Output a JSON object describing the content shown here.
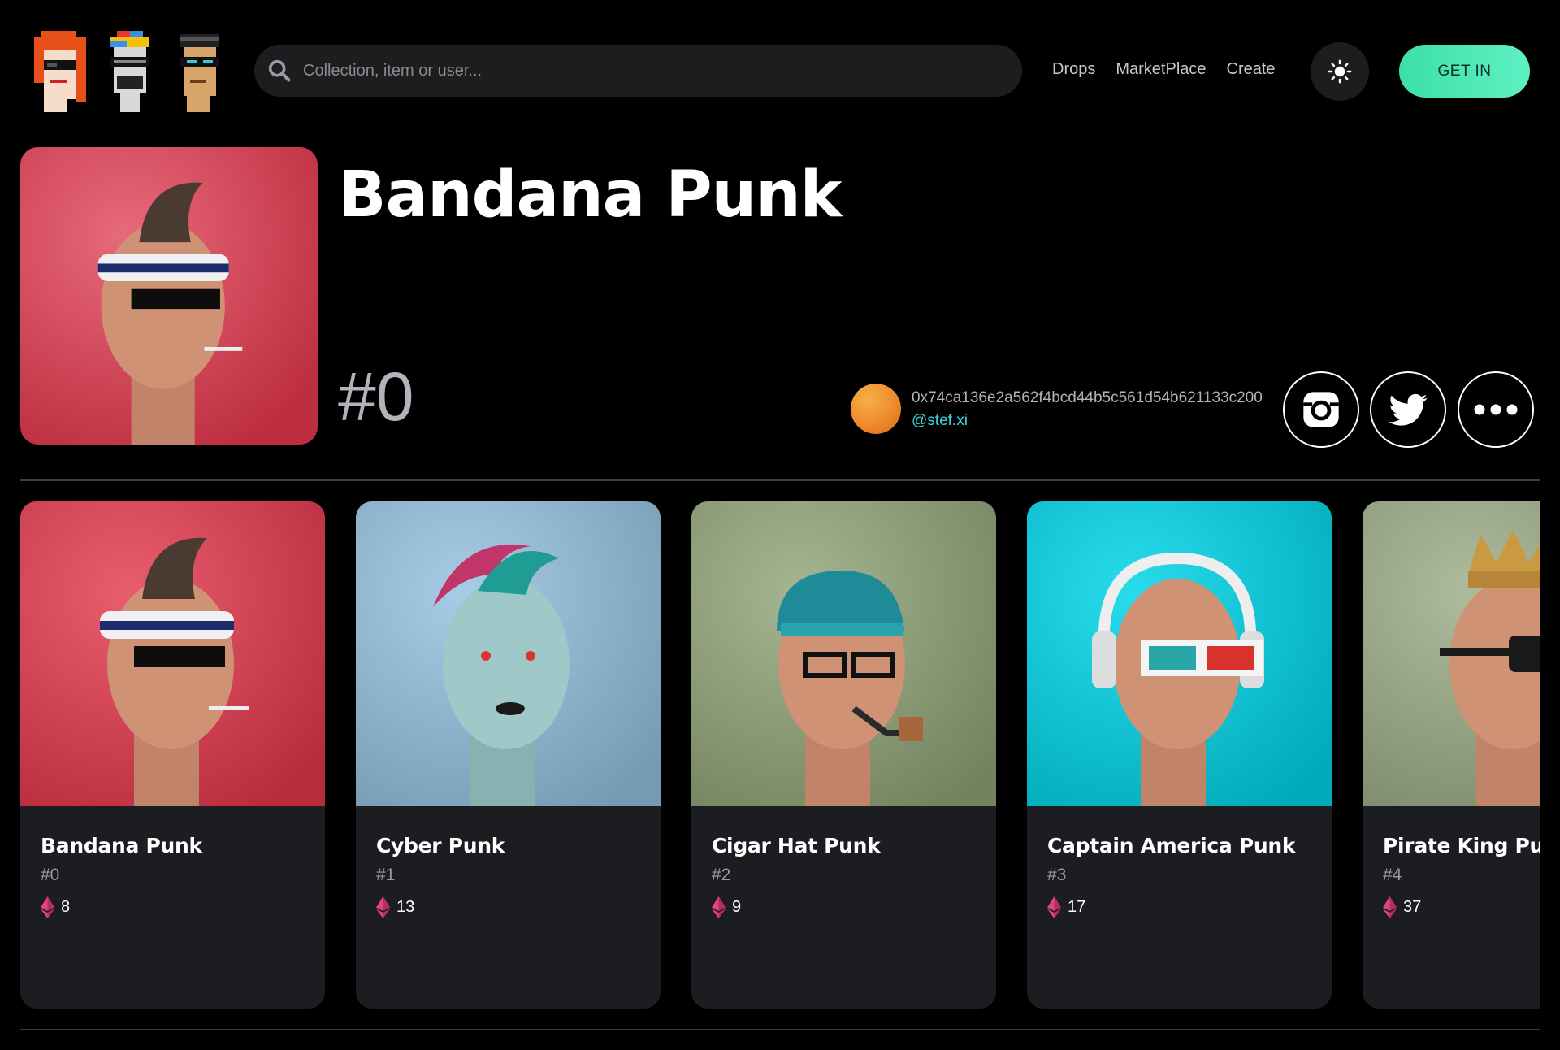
{
  "header": {
    "logo_icon": "pixel-punks-logo",
    "search": {
      "placeholder": "Collection, item or user...",
      "value": "",
      "icon": "search-icon"
    },
    "nav": [
      {
        "label": "Drops"
      },
      {
        "label": "MarketPlace"
      },
      {
        "label": "Create"
      }
    ],
    "theme_icon": "sun-icon",
    "cta_label": "GET IN",
    "cta_color": "#4ceab5"
  },
  "hero": {
    "title": "Bandana Punk",
    "number": "#0",
    "image": "bandana-punk-portrait",
    "image_bg": "#d04456",
    "owner": {
      "address": "0x74ca136e2a562f4bcd44b5c561d54b621133c200",
      "handle": "@stef.xi"
    },
    "actions": [
      {
        "icon": "instagram-icon"
      },
      {
        "icon": "twitter-icon"
      },
      {
        "icon": "more-icon"
      }
    ]
  },
  "colors": {
    "background": "#000000",
    "card": "#1c1d20",
    "accent": "#38d7e0",
    "price_icon": "#e0457b"
  },
  "cards": [
    {
      "name": "Bandana Punk",
      "number": "#0",
      "price": "8",
      "bg": "#d04456",
      "variant": "bandana"
    },
    {
      "name": "Cyber Punk",
      "number": "#1",
      "price": "13",
      "bg": "#8fb3cc",
      "variant": "cyber"
    },
    {
      "name": "Cigar Hat Punk",
      "number": "#2",
      "price": "9",
      "bg": "#8d9c78",
      "variant": "cigar"
    },
    {
      "name": "Captain America Punk",
      "number": "#3",
      "price": "17",
      "bg": "#0fc3d3",
      "variant": "captain"
    },
    {
      "name": "Pirate King Punk",
      "number": "#4",
      "price": "37",
      "bg": "#95a283",
      "variant": "pirate"
    }
  ]
}
